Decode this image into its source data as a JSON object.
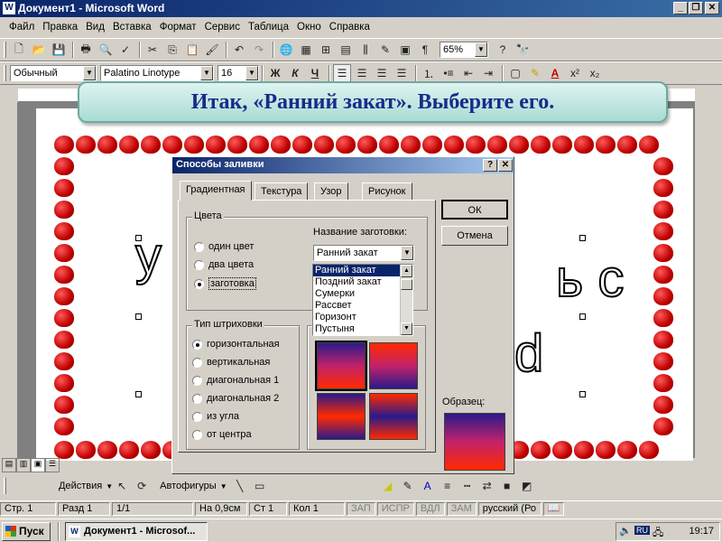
{
  "window": {
    "title": "Документ1 - Microsoft Word"
  },
  "menu": [
    "Файл",
    "Правка",
    "Вид",
    "Вставка",
    "Формат",
    "Сервис",
    "Таблица",
    "Окно",
    "Справка"
  ],
  "toolbar": {
    "zoom": "65%",
    "style": "Обычный",
    "font": "Palatino Linotype",
    "size": "16",
    "bold": "Ж",
    "italic": "К",
    "underline": "Ч"
  },
  "banner": {
    "text": "Итак, «Ранний закат». Выберите его."
  },
  "dialog": {
    "title": "Способы заливки",
    "tabs": [
      "Градиентная",
      "Текстура",
      "Узор",
      "Рисунок"
    ],
    "colors_group": "Цвета",
    "color_options": [
      "один цвет",
      "два цвета",
      "заготовка"
    ],
    "preset_label": "Название заготовки:",
    "preset_value": "Ранний закат",
    "preset_list": [
      "Ранний закат",
      "Поздний закат",
      "Сумерки",
      "Рассвет",
      "Горизонт",
      "Пустыня"
    ],
    "hatch_group": "Тип штриховки",
    "hatch_options": [
      "горизонтальная",
      "вертикальная",
      "диагональная 1",
      "диагональная 2",
      "из угла",
      "от центра"
    ],
    "ok": "ОК",
    "cancel": "Отмена",
    "sample_label": "Образец:"
  },
  "drawing_toolbar": {
    "actions": "Действия",
    "autoshapes": "Автофигуры"
  },
  "status": {
    "page": "Стр. 1",
    "section": "Разд 1",
    "pages": "1/1",
    "position": "На 0,9см",
    "line": "Ст 1",
    "column": "Кол 1",
    "rec": "ЗАП",
    "trk": "ИСПР",
    "ext": "ВДЛ",
    "ovr": "ЗАМ",
    "lang": "русский (Ро"
  },
  "taskbar": {
    "start": "Пуск",
    "task": "Документ1 - Microsof...",
    "lang": "RU",
    "time": "19:17"
  },
  "colors": {
    "title_active": "#0a246a",
    "apple": "#c00000",
    "banner_text": "#1a2a8a"
  }
}
